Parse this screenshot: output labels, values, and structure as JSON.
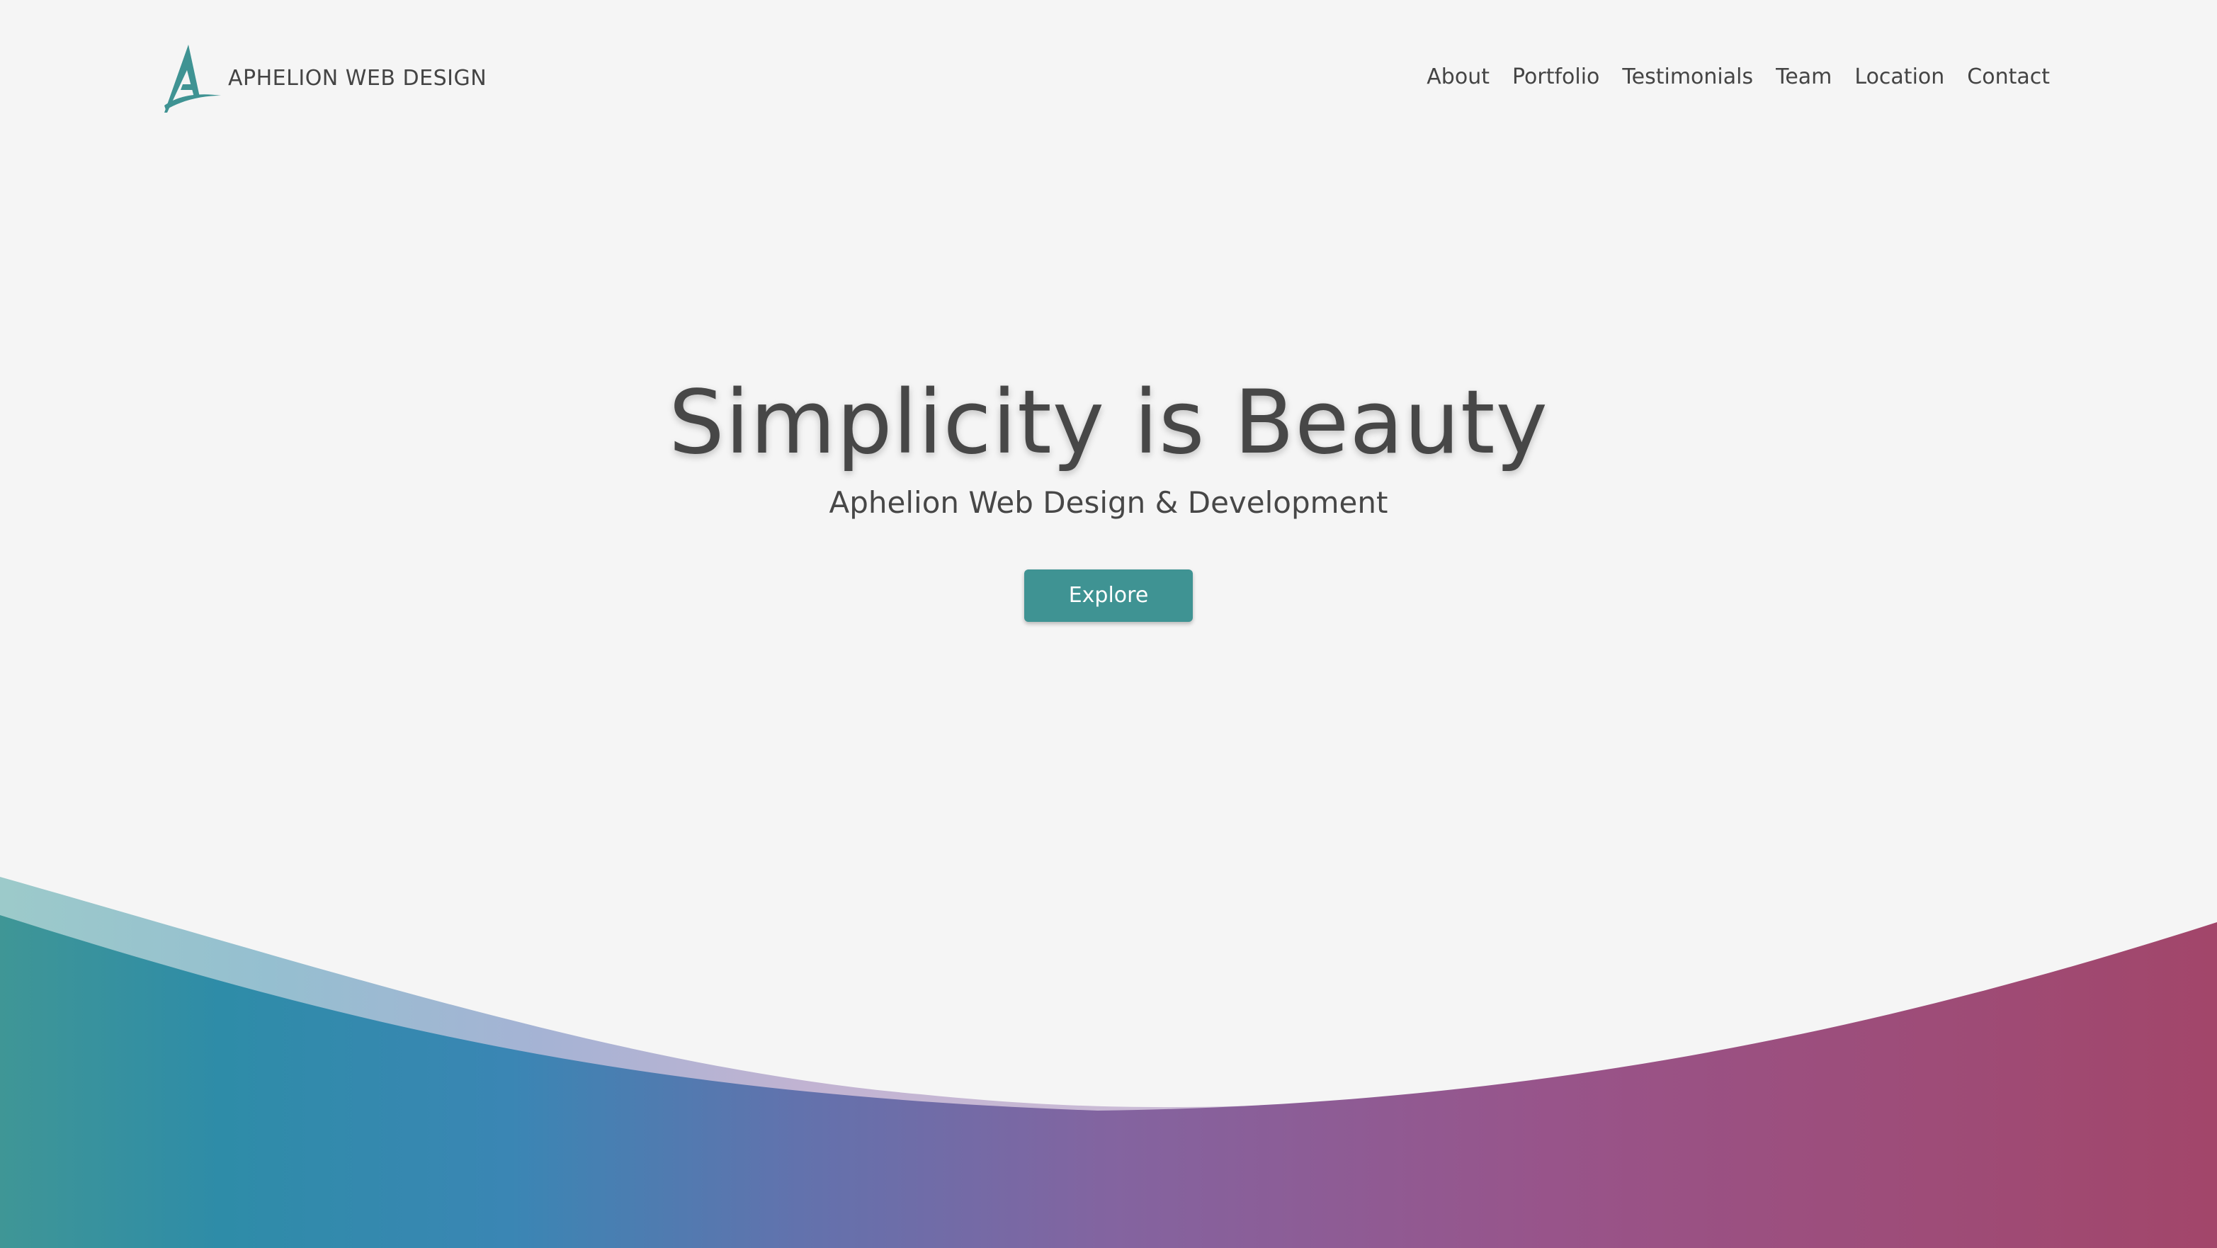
{
  "brand": {
    "name": "APHELION WEB DESIGN",
    "logo_icon": "aphelion-a-logo-icon",
    "accent_color": "#3f9393"
  },
  "nav": {
    "items": [
      {
        "label": "About"
      },
      {
        "label": "Portfolio"
      },
      {
        "label": "Testimonials"
      },
      {
        "label": "Team"
      },
      {
        "label": "Location"
      },
      {
        "label": "Contact"
      }
    ]
  },
  "hero": {
    "title": "Simplicity is Beauty",
    "subtitle": "Aphelion Web Design & Development",
    "button_label": "Explore"
  },
  "colors": {
    "background": "#f5f5f5",
    "text": "#474747",
    "button": "#3f9393",
    "wave_left": "#3f9696",
    "wave_mid": "#8364a0",
    "wave_right": "#a2466a"
  }
}
